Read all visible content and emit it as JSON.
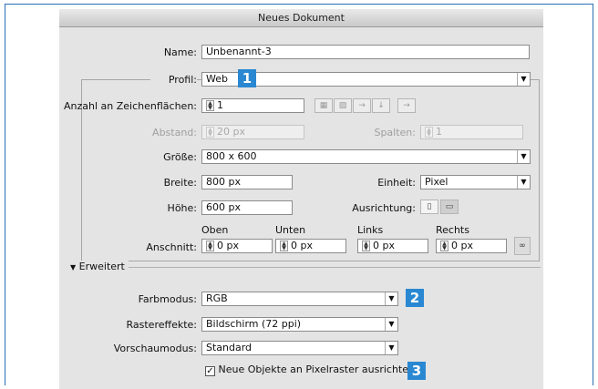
{
  "dialog": {
    "title": "Neues Dokument"
  },
  "name": {
    "label": "Name:",
    "value": "Unbenannt-3"
  },
  "profil": {
    "label": "Profil:",
    "value": "Web"
  },
  "zeichenflaechen": {
    "label": "Anzahl an Zeichenflächen:",
    "value": "1"
  },
  "abstand": {
    "label": "Abstand:",
    "value": "20 px"
  },
  "spalten": {
    "label": "Spalten:",
    "value": "1"
  },
  "groesse": {
    "label": "Größe:",
    "value": "800 x 600"
  },
  "breite": {
    "label": "Breite:",
    "value": "800 px"
  },
  "einheit": {
    "label": "Einheit:",
    "value": "Pixel"
  },
  "hoehe": {
    "label": "Höhe:",
    "value": "600 px"
  },
  "ausrichtung": {
    "label": "Ausrichtung:"
  },
  "anschnitt": {
    "label": "Anschnitt:",
    "oben_label": "Oben",
    "oben_value": "0 px",
    "unten_label": "Unten",
    "unten_value": "0 px",
    "links_label": "Links",
    "links_value": "0 px",
    "rechts_label": "Rechts",
    "rechts_value": "0 px"
  },
  "erweitert": {
    "label": "Erweitert"
  },
  "farbmodus": {
    "label": "Farbmodus:",
    "value": "RGB"
  },
  "rastereffekte": {
    "label": "Rastereffekte:",
    "value": "Bildschirm (72 ppi)"
  },
  "vorschaumodus": {
    "label": "Vorschaumodus:",
    "value": "Standard"
  },
  "pixelraster": {
    "label": "Neue Objekte an Pixelraster ausrichten",
    "checked": true
  },
  "badges": {
    "one": "1",
    "two": "2",
    "three": "3"
  },
  "colors": {
    "badge": "#2a88d2",
    "frame": "#2a6fb5",
    "dialog_bg": "#e4e4e4"
  }
}
